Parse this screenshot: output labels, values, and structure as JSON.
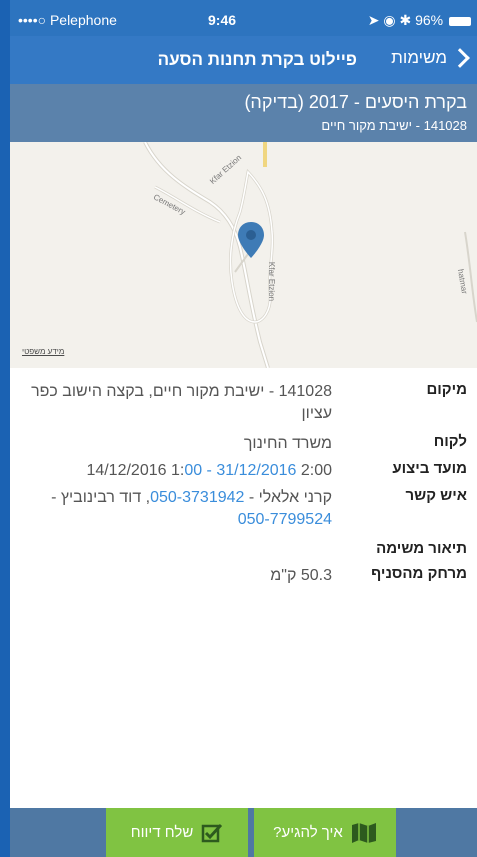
{
  "status_bar": {
    "carrier": "••••○ Pelephone",
    "time": "9:46",
    "battery": "96%"
  },
  "nav_bar": {
    "back_label": "משימות",
    "title": "פיילוט בקרת תחנות הסעה"
  },
  "header": {
    "title": "בקרת היסעים - 2017 (בדיקה)",
    "subtitle": "141028 - ישיבת מקור חיים"
  },
  "map": {
    "labels": [
      "Kfar Etzion",
      "Cemetery",
      "Kfar Etzion",
      "hatmar"
    ],
    "legal_link": "מידע משפטי"
  },
  "details": {
    "location_label": "מיקום",
    "location_value": "141028 - ישיבת מקור חיים, בקצה הישוב כפר עציון",
    "customer_label": "לקוח",
    "customer_value": "משרד החינוך",
    "schedule_label": "מועד ביצוע",
    "schedule_start": "14/12/2016 1:",
    "schedule_link": "00 - 31/12/2016",
    "schedule_end": " 2:00",
    "contact_label": "איש קשר",
    "contact_name1": "קרני אלאלי - ",
    "contact_phone1": "050-3731942",
    "contact_name2": ", דוד רבינוביץ - ",
    "contact_phone2": "050-7799524",
    "description_label": "תיאור משימה",
    "distance_label": "מרחק מהסניף",
    "distance_value": "50.3 ק\"מ"
  },
  "toolbar": {
    "report_label": "שלח דיווח",
    "navigate_label": "איך להגיע?"
  },
  "colors": {
    "nav": "#3479c5",
    "subheader": "#5b82ab",
    "button": "#80c342",
    "link": "#3a8ddb",
    "pin": "#3e7bb6"
  }
}
